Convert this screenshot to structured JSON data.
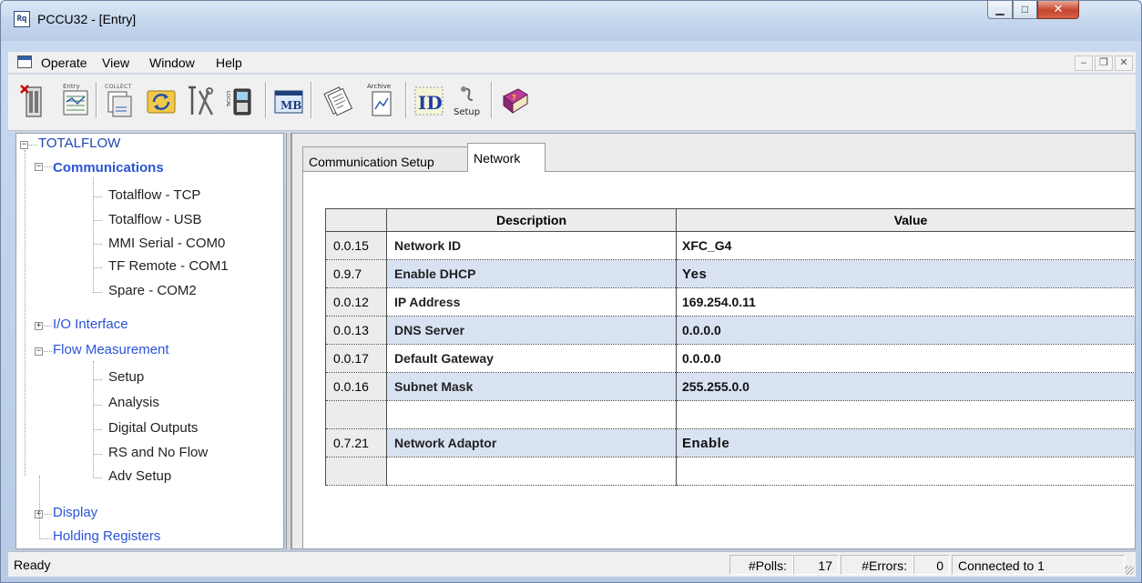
{
  "window": {
    "title": "PCCU32 - [Entry]",
    "app_icon_text": "Rq"
  },
  "menu": {
    "operate": "Operate",
    "view": "View",
    "window": "Window",
    "help": "Help"
  },
  "toolbar": {
    "entry_label": "Entry",
    "collect_label": "COLLECT",
    "archive_label": "Archive",
    "setup_label": "Setup",
    "local_label": "LOCAL",
    "mb_label": "MB",
    "id_label": "ID",
    "icons": [
      "exit-icon",
      "entry-icon",
      "collect-icon",
      "refresh-icon",
      "tools-icon",
      "local-icon",
      "modbus-icon",
      "report-icon",
      "archive-icon",
      "id-manager-icon",
      "setup-icon",
      "help-book-icon"
    ]
  },
  "tree": {
    "root": "TOTALFLOW",
    "communications": "Communications",
    "comm_items": [
      "Totalflow - TCP",
      "Totalflow - USB",
      "MMI Serial - COM0",
      "TF Remote - COM1",
      "Spare - COM2"
    ],
    "io_interface": "I/O Interface",
    "flow_measurement": "Flow Measurement",
    "flow_items": [
      "Setup",
      "Analysis",
      "Digital Outputs",
      "RS and No Flow",
      "Adv Setup"
    ],
    "display": "Display",
    "holding_registers": "Holding Registers"
  },
  "tabs": {
    "communication_setup": "Communication Setup",
    "network": "Network"
  },
  "grid": {
    "header_description": "Description",
    "header_value": "Value",
    "rows": [
      {
        "reg": "0.0.15",
        "desc": "Network ID",
        "value": "XFC_G4"
      },
      {
        "reg": "0.9.7",
        "desc": "Enable DHCP",
        "value": "Yes"
      },
      {
        "reg": "0.0.12",
        "desc": "IP Address",
        "value": "169.254.0.11"
      },
      {
        "reg": "0.0.13",
        "desc": "DNS Server",
        "value": "0.0.0.0"
      },
      {
        "reg": "0.0.17",
        "desc": "Default Gateway",
        "value": "0.0.0.0"
      },
      {
        "reg": "0.0.16",
        "desc": "Subnet Mask",
        "value": "255.255.0.0"
      },
      {
        "reg": "",
        "desc": "",
        "value": ""
      },
      {
        "reg": "0.7.21",
        "desc": "Network Adaptor",
        "value": "Enable"
      },
      {
        "reg": "",
        "desc": "",
        "value": ""
      }
    ]
  },
  "statusbar": {
    "ready": "Ready",
    "polls_label": "#Polls:",
    "polls_value": "17",
    "errors_label": "#Errors:",
    "errors_value": "0",
    "connection": "Connected to 1"
  }
}
